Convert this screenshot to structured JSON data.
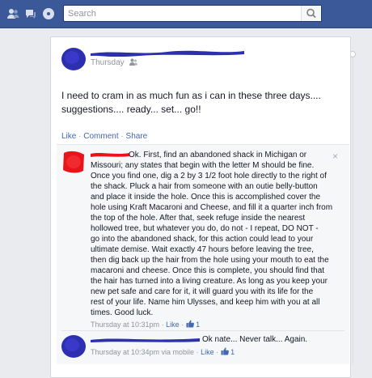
{
  "topbar": {
    "search_placeholder": "Search",
    "icons": [
      "friend-requests-icon",
      "messages-icon",
      "notifications-icon"
    ]
  },
  "post": {
    "meta_time": "Thursday",
    "audience_icon": "friends-audience-icon",
    "text": "I need to cram in as much fun as i can in these three days....\nsuggestions.... ready... set... go!!",
    "actions": {
      "like": "Like",
      "comment": "Comment",
      "share": "Share",
      "separator": "·"
    }
  },
  "comments": [
    {
      "lines": [
        "Ok. First, find an abandoned shack in Michigan or",
        "Missouri; any states that begin with the letter M should be fine.",
        "Once you find one, dig a 2 by 3 1/2 foot hole directly to the right of",
        "the shack. Pluck a hair from someone with an outie belly-button",
        "and place it inside the hole. Once this is accomplished cover the",
        "hole using Kraft Macaroni and Cheese, and fill it a quarter inch from",
        "the top of the hole. After that, seek refuge inside the nearest",
        "hollowed tree, but whatever you do, do not - I repeat, DO NOT -",
        "go into the abandoned shack, for this action could lead to your",
        "ultimate demise. Wait exactly 47 hours before leaving the tree,",
        "then dig back up the hair from the hole using your mouth to eat the",
        "macaroni and cheese. Once this is complete, you should find that",
        "the hair has turned into a living creature. As long as you keep your",
        "new pet safe and care for it, it will guard you with its life for the",
        "rest of your life. Name him Ulysses, and keep him with you at all",
        "times. Good luck."
      ],
      "time": "Thursday at 10:31pm",
      "like": "Like",
      "like_count": "1"
    },
    {
      "text": "Ok nate... Never talk... Again.",
      "time": "Thursday at 10:34pm via mobile",
      "like": "Like",
      "like_count": "1"
    }
  ],
  "close_label": "×",
  "colors": {
    "topbar": "#3b5998",
    "link": "#4267b2",
    "redaction_blue": "#2b2fb0",
    "redaction_red": "#e8141a"
  }
}
